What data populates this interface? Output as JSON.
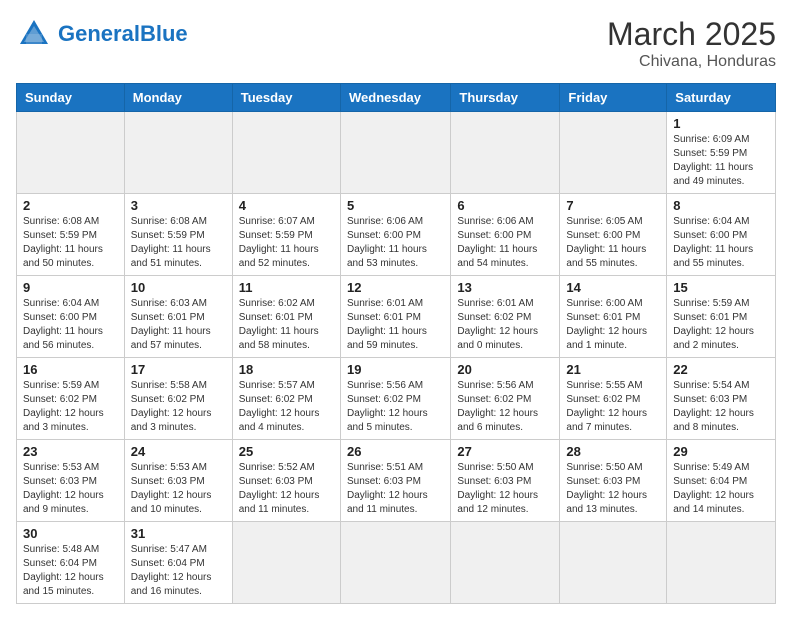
{
  "header": {
    "logo_general": "General",
    "logo_blue": "Blue",
    "month_title": "March 2025",
    "location": "Chivana, Honduras"
  },
  "weekdays": [
    "Sunday",
    "Monday",
    "Tuesday",
    "Wednesday",
    "Thursday",
    "Friday",
    "Saturday"
  ],
  "weeks": [
    [
      {
        "day": "",
        "info": ""
      },
      {
        "day": "",
        "info": ""
      },
      {
        "day": "",
        "info": ""
      },
      {
        "day": "",
        "info": ""
      },
      {
        "day": "",
        "info": ""
      },
      {
        "day": "",
        "info": ""
      },
      {
        "day": "1",
        "info": "Sunrise: 6:09 AM\nSunset: 5:59 PM\nDaylight: 11 hours\nand 49 minutes."
      }
    ],
    [
      {
        "day": "2",
        "info": "Sunrise: 6:08 AM\nSunset: 5:59 PM\nDaylight: 11 hours\nand 50 minutes."
      },
      {
        "day": "3",
        "info": "Sunrise: 6:08 AM\nSunset: 5:59 PM\nDaylight: 11 hours\nand 51 minutes."
      },
      {
        "day": "4",
        "info": "Sunrise: 6:07 AM\nSunset: 5:59 PM\nDaylight: 11 hours\nand 52 minutes."
      },
      {
        "day": "5",
        "info": "Sunrise: 6:06 AM\nSunset: 6:00 PM\nDaylight: 11 hours\nand 53 minutes."
      },
      {
        "day": "6",
        "info": "Sunrise: 6:06 AM\nSunset: 6:00 PM\nDaylight: 11 hours\nand 54 minutes."
      },
      {
        "day": "7",
        "info": "Sunrise: 6:05 AM\nSunset: 6:00 PM\nDaylight: 11 hours\nand 55 minutes."
      },
      {
        "day": "8",
        "info": "Sunrise: 6:04 AM\nSunset: 6:00 PM\nDaylight: 11 hours\nand 55 minutes."
      }
    ],
    [
      {
        "day": "9",
        "info": "Sunrise: 6:04 AM\nSunset: 6:00 PM\nDaylight: 11 hours\nand 56 minutes."
      },
      {
        "day": "10",
        "info": "Sunrise: 6:03 AM\nSunset: 6:01 PM\nDaylight: 11 hours\nand 57 minutes."
      },
      {
        "day": "11",
        "info": "Sunrise: 6:02 AM\nSunset: 6:01 PM\nDaylight: 11 hours\nand 58 minutes."
      },
      {
        "day": "12",
        "info": "Sunrise: 6:01 AM\nSunset: 6:01 PM\nDaylight: 11 hours\nand 59 minutes."
      },
      {
        "day": "13",
        "info": "Sunrise: 6:01 AM\nSunset: 6:02 PM\nDaylight: 12 hours\nand 0 minutes."
      },
      {
        "day": "14",
        "info": "Sunrise: 6:00 AM\nSunset: 6:01 PM\nDaylight: 12 hours\nand 1 minute."
      },
      {
        "day": "15",
        "info": "Sunrise: 5:59 AM\nSunset: 6:01 PM\nDaylight: 12 hours\nand 2 minutes."
      }
    ],
    [
      {
        "day": "16",
        "info": "Sunrise: 5:59 AM\nSunset: 6:02 PM\nDaylight: 12 hours\nand 3 minutes."
      },
      {
        "day": "17",
        "info": "Sunrise: 5:58 AM\nSunset: 6:02 PM\nDaylight: 12 hours\nand 3 minutes."
      },
      {
        "day": "18",
        "info": "Sunrise: 5:57 AM\nSunset: 6:02 PM\nDaylight: 12 hours\nand 4 minutes."
      },
      {
        "day": "19",
        "info": "Sunrise: 5:56 AM\nSunset: 6:02 PM\nDaylight: 12 hours\nand 5 minutes."
      },
      {
        "day": "20",
        "info": "Sunrise: 5:56 AM\nSunset: 6:02 PM\nDaylight: 12 hours\nand 6 minutes."
      },
      {
        "day": "21",
        "info": "Sunrise: 5:55 AM\nSunset: 6:02 PM\nDaylight: 12 hours\nand 7 minutes."
      },
      {
        "day": "22",
        "info": "Sunrise: 5:54 AM\nSunset: 6:03 PM\nDaylight: 12 hours\nand 8 minutes."
      }
    ],
    [
      {
        "day": "23",
        "info": "Sunrise: 5:53 AM\nSunset: 6:03 PM\nDaylight: 12 hours\nand 9 minutes."
      },
      {
        "day": "24",
        "info": "Sunrise: 5:53 AM\nSunset: 6:03 PM\nDaylight: 12 hours\nand 10 minutes."
      },
      {
        "day": "25",
        "info": "Sunrise: 5:52 AM\nSunset: 6:03 PM\nDaylight: 12 hours\nand 11 minutes."
      },
      {
        "day": "26",
        "info": "Sunrise: 5:51 AM\nSunset: 6:03 PM\nDaylight: 12 hours\nand 11 minutes."
      },
      {
        "day": "27",
        "info": "Sunrise: 5:50 AM\nSunset: 6:03 PM\nDaylight: 12 hours\nand 12 minutes."
      },
      {
        "day": "28",
        "info": "Sunrise: 5:50 AM\nSunset: 6:03 PM\nDaylight: 12 hours\nand 13 minutes."
      },
      {
        "day": "29",
        "info": "Sunrise: 5:49 AM\nSunset: 6:04 PM\nDaylight: 12 hours\nand 14 minutes."
      }
    ],
    [
      {
        "day": "30",
        "info": "Sunrise: 5:48 AM\nSunset: 6:04 PM\nDaylight: 12 hours\nand 15 minutes."
      },
      {
        "day": "31",
        "info": "Sunrise: 5:47 AM\nSunset: 6:04 PM\nDaylight: 12 hours\nand 16 minutes."
      },
      {
        "day": "",
        "info": ""
      },
      {
        "day": "",
        "info": ""
      },
      {
        "day": "",
        "info": ""
      },
      {
        "day": "",
        "info": ""
      },
      {
        "day": "",
        "info": ""
      }
    ]
  ]
}
